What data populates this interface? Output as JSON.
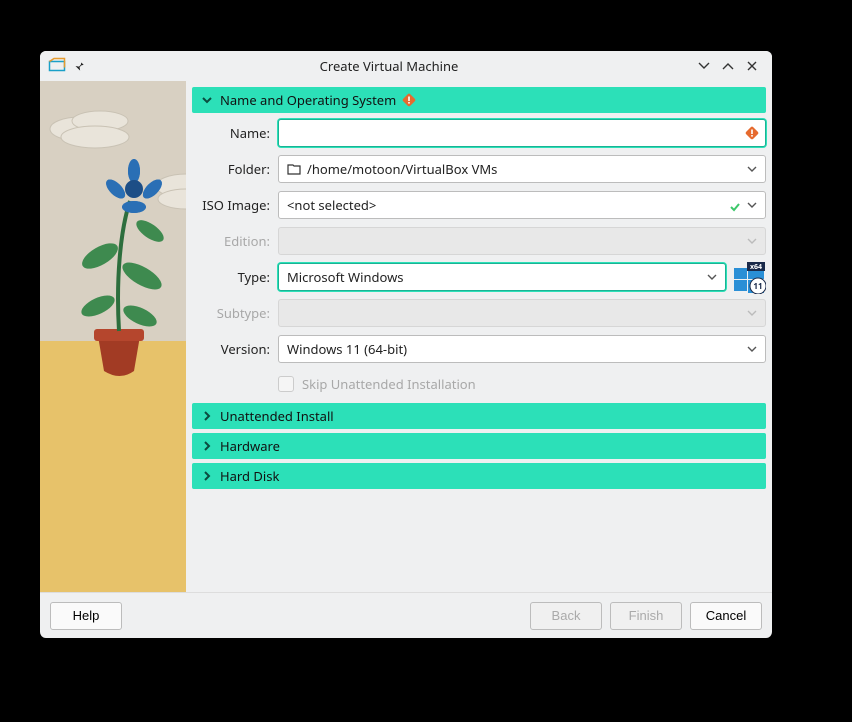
{
  "window": {
    "title": "Create Virtual Machine"
  },
  "sections": {
    "name_os": {
      "label": "Name and Operating System"
    },
    "unattended": {
      "label": "Unattended Install"
    },
    "hardware": {
      "label": "Hardware"
    },
    "hdd": {
      "label": "Hard Disk"
    }
  },
  "labels": {
    "name": "Name:",
    "folder": "Folder:",
    "iso": "ISO Image:",
    "edition": "Edition:",
    "type": "Type:",
    "subtype": "Subtype:",
    "version": "Version:",
    "skip": "Skip Unattended Installation"
  },
  "values": {
    "name": "",
    "folder": "/home/motoon/VirtualBox VMs",
    "iso": "<not selected>",
    "edition": "",
    "type": "Microsoft Windows",
    "subtype": "",
    "version": "Windows 11 (64-bit)"
  },
  "buttons": {
    "help": "Help",
    "back": "Back",
    "finish": "Finish",
    "cancel": "Cancel"
  },
  "os_badge": {
    "arch": "x64",
    "ver": "11"
  }
}
